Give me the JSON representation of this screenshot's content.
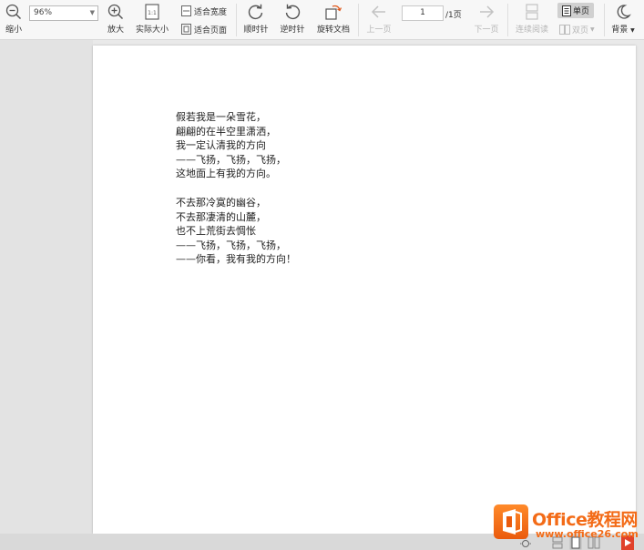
{
  "toolbar": {
    "zoom_out_label": "缩小",
    "zoom_value": "96%",
    "zoom_in_label": "放大",
    "actual_size_label": "实际大小",
    "actual_size_glyph": "1:1",
    "fit_width_label": "适合宽度",
    "fit_page_label": "适合页面",
    "rotate_cw_label": "顺时针",
    "rotate_ccw_label": "逆时针",
    "rotate_doc_label": "旋转文档",
    "prev_page_label": "上一页",
    "page_current": "1",
    "page_total": "/1页",
    "next_page_label": "下一页",
    "continuous_label": "连续阅读",
    "single_page_label": "单页",
    "double_page_label": "双页",
    "background_label": "背景"
  },
  "document": {
    "stanza1": [
      "假若我是一朵雪花，",
      "翩翩的在半空里潇洒，",
      "我一定认清我的方向",
      "——飞扬，飞扬，飞扬，",
      "这地面上有我的方向。"
    ],
    "stanza2": [
      "不去那冷寞的幽谷，",
      "不去那凄清的山麓，",
      "也不上荒街去惆怅",
      "——飞扬，飞扬，飞扬，",
      "——你看，我有我的方向！"
    ]
  },
  "watermark": {
    "line1": "Office教程网",
    "line2": "www.office26.com"
  },
  "colors": {
    "accent_orange": "#f36b17",
    "toolbar_bg": "#f7f7f7",
    "canvas_bg": "#e9e9e9"
  }
}
